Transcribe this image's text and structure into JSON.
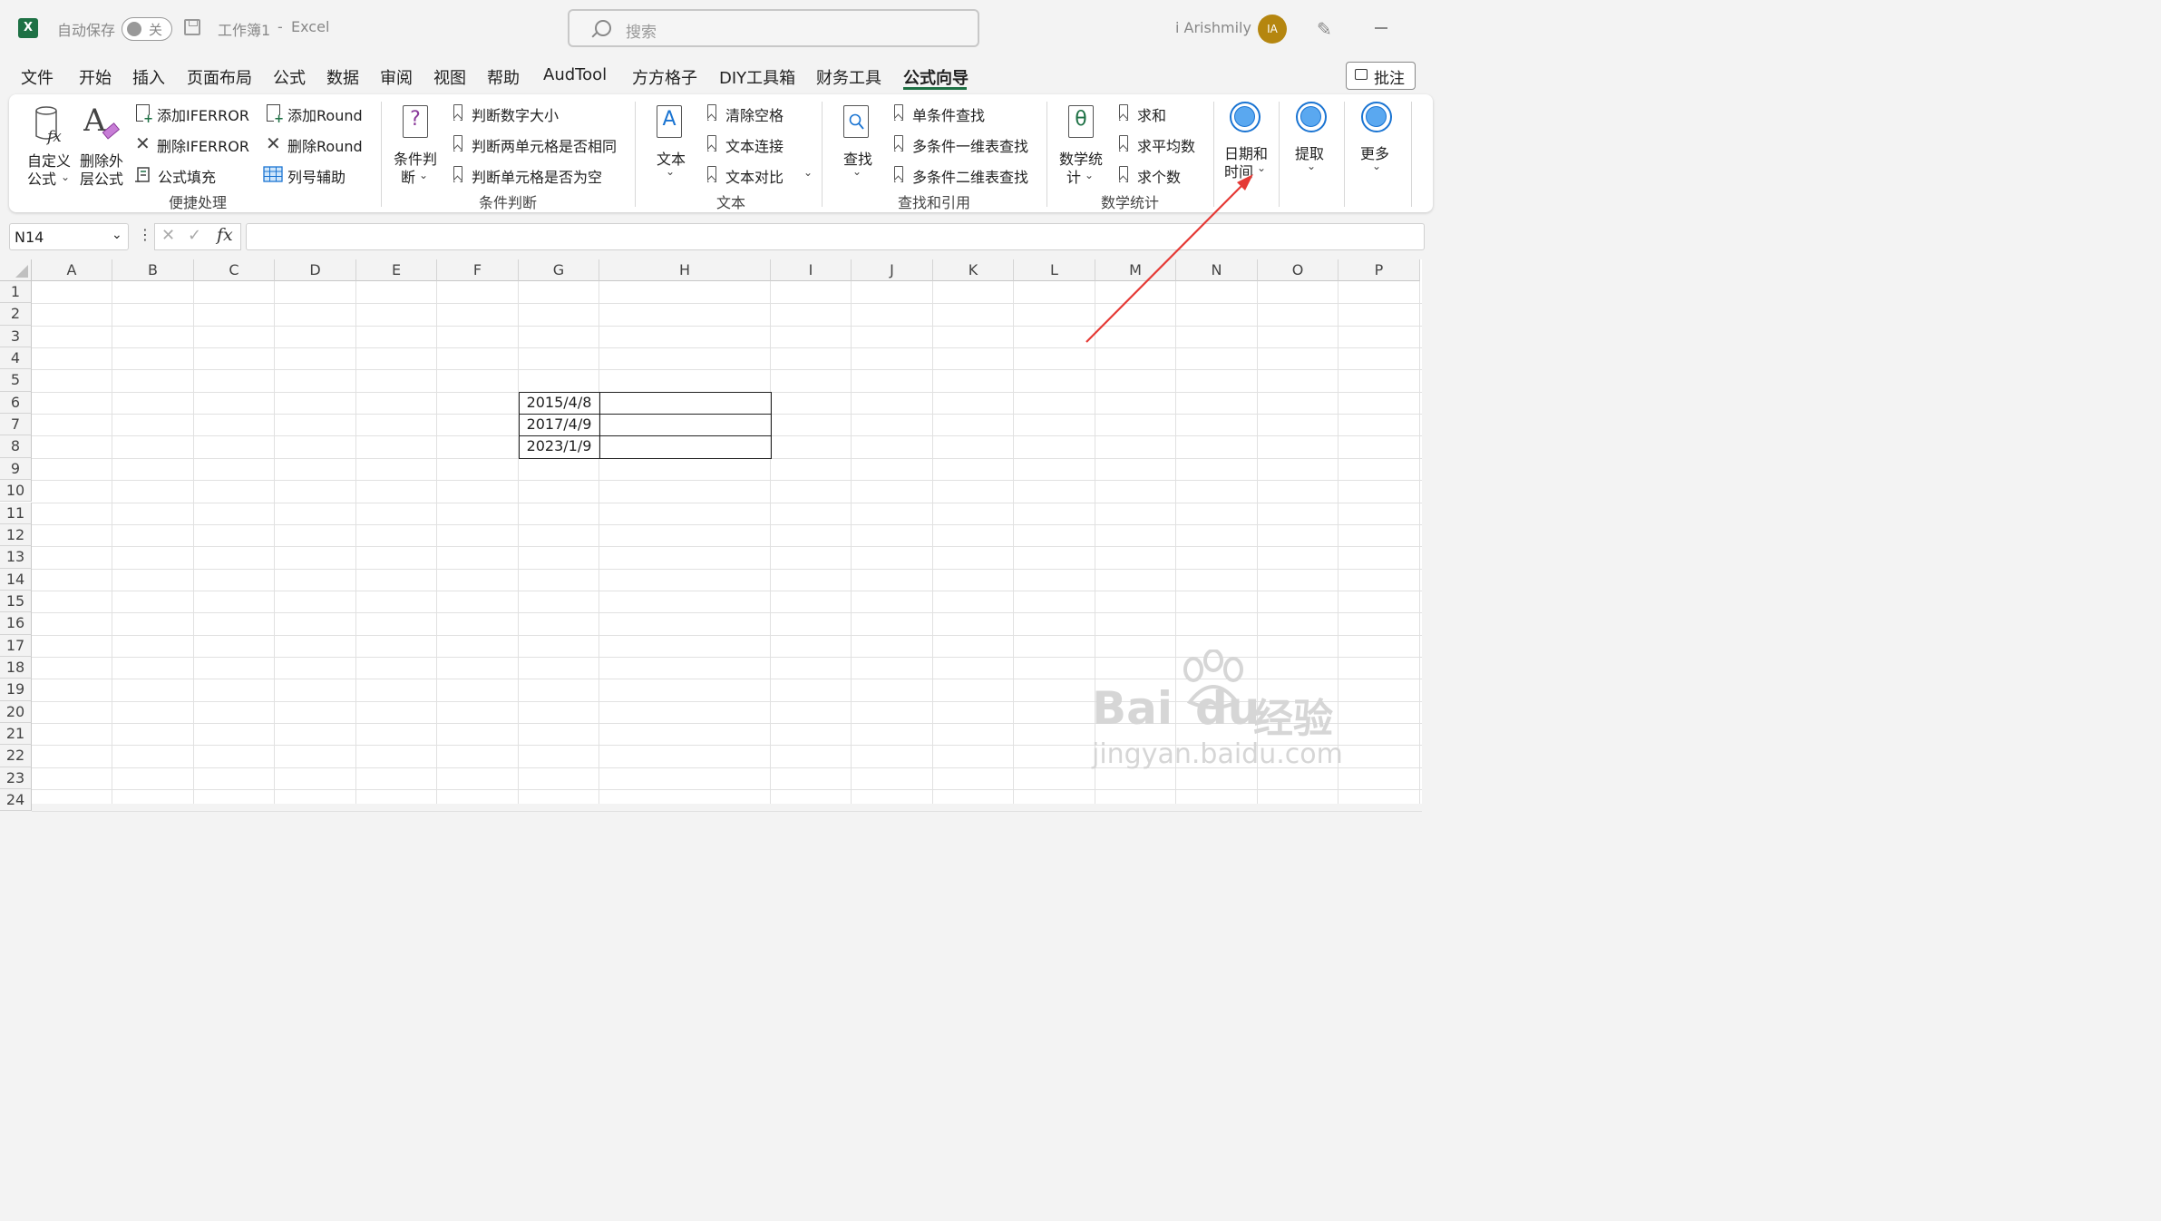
{
  "titlebar": {
    "app_icon": "excel-icon",
    "autosave_label": "自动保存",
    "toggle_state": "关",
    "doc_title": "工作簿1",
    "sep": "-",
    "app_name": "Excel",
    "search_placeholder": "搜索",
    "user_name": "i Arishmily",
    "avatar_initials": "IA"
  },
  "tabs": [
    "文件",
    "开始",
    "插入",
    "页面布局",
    "公式",
    "数据",
    "审阅",
    "视图",
    "帮助",
    "AudTool",
    "方方格子",
    "DIY工具箱",
    "财务工具",
    "公式向导"
  ],
  "comment_button": "批注",
  "ribbon": {
    "quick": {
      "custom_formula": [
        "自定义",
        "公式"
      ],
      "delete_outer": [
        "删除外",
        "层公式"
      ],
      "add_iferror": "添加IFERROR",
      "del_iferror": "删除IFERROR",
      "fill_formula": "公式填充",
      "add_round": "添加Round",
      "del_round": "删除Round",
      "col_helper": "列号辅助",
      "group": "便捷处理"
    },
    "cond": {
      "big": [
        "条件判",
        "断"
      ],
      "items": [
        "判断数字大小",
        "判断两单元格是否相同",
        "判断单元格是否为空"
      ],
      "group": "条件判断"
    },
    "text": {
      "big": "文本",
      "items": [
        "清除空格",
        "文本连接",
        "文本对比"
      ],
      "group": "文本"
    },
    "lookup": {
      "big": "查找",
      "items": [
        "单条件查找",
        "多条件一维表查找",
        "多条件二维表查找"
      ],
      "group": "查找和引用"
    },
    "math": {
      "big": [
        "数学统",
        "计"
      ],
      "items": [
        "求和",
        "求平均数",
        "求个数"
      ],
      "group": "数学统计"
    },
    "datetime": [
      "日期和",
      "时间"
    ],
    "extract": "提取",
    "more": "更多"
  },
  "formula_bar": {
    "name_box": "N14",
    "fx": "fx",
    "formula": ""
  },
  "grid": {
    "columns": [
      "A",
      "B",
      "C",
      "D",
      "E",
      "F",
      "G",
      "H",
      "I",
      "J",
      "K",
      "L",
      "M",
      "N",
      "O",
      "P"
    ],
    "rows": [
      "1",
      "2",
      "3",
      "4",
      "5",
      "6",
      "7",
      "8",
      "9",
      "10",
      "11",
      "12",
      "13",
      "14",
      "15",
      "16",
      "17",
      "18",
      "19",
      "20",
      "21",
      "22",
      "23",
      "24"
    ],
    "cells": {
      "G6": "2015/4/8",
      "G7": "2017/4/9",
      "G8": "2023/1/9"
    }
  },
  "watermark": {
    "brand": "Bai",
    "brand2": "du",
    "cn": "经验",
    "url": "jingyan.baidu.com"
  },
  "colors": {
    "excel_green": "#1e7145",
    "annotation_arrow": "#e53935",
    "circle_blue": "#1a74d2"
  }
}
